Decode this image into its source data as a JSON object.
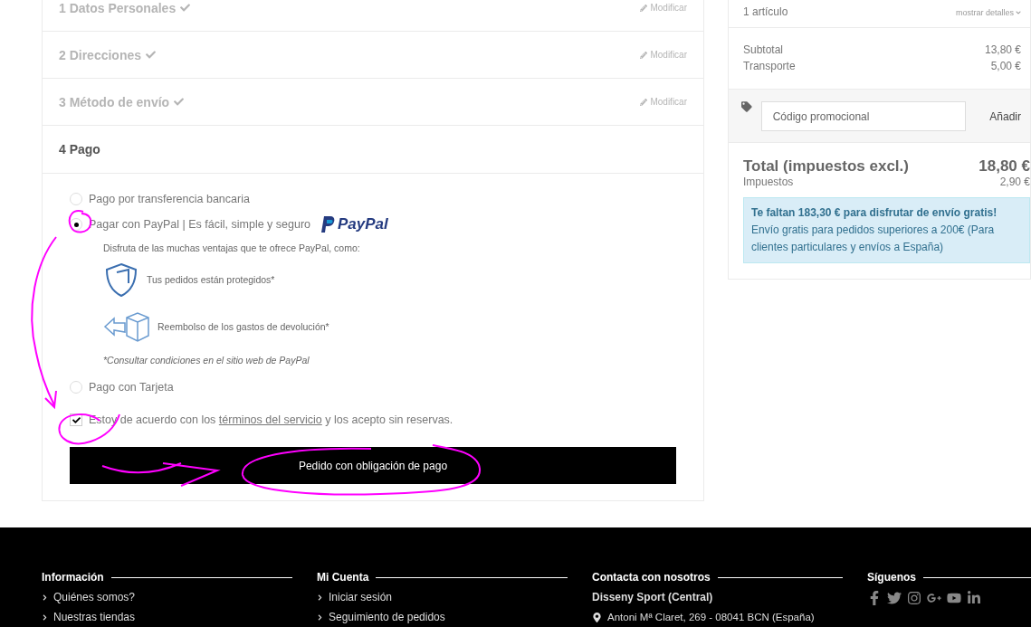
{
  "steps": [
    {
      "title": "1 Datos Personales",
      "complete": true,
      "edit_label": "Modificar"
    },
    {
      "title": "2 Direcciones",
      "complete": true,
      "edit_label": "Modificar"
    },
    {
      "title": "3 Método de envío",
      "complete": true,
      "edit_label": "Modificar"
    },
    {
      "title": "4 Pago",
      "complete": false
    }
  ],
  "payment": {
    "options": [
      {
        "label": "Pago por transferencia bancaria",
        "selected": false
      },
      {
        "label": "Pagar con PayPal | Es fácil, simple y seguro",
        "selected": true,
        "logo_text": "PayPal",
        "intro": "Disfruta de las muchas ventajas que te ofrece PayPal, como:",
        "benefits": [
          {
            "kind": "shield",
            "text": "Tus pedidos están protegidos*"
          },
          {
            "kind": "return",
            "text": "Reembolso de los gastos de devolución*"
          }
        ],
        "note": "*Consultar condiciones en el sitio web de PayPal"
      },
      {
        "label": "Pago con Tarjeta",
        "selected": false
      }
    ],
    "terms": {
      "checked": true,
      "before": "Estoy de acuerdo con los",
      "link": "términos del servicio",
      "after": "y los acepto sin reservas."
    },
    "submit_button": "Pedido con obligación de pago"
  },
  "summary": {
    "items_count": "1 artículo",
    "details_toggle": "mostrar detalles",
    "lines": [
      {
        "label": "Subtotal",
        "value": "13,80 €"
      },
      {
        "label": "Transporte",
        "value": "5,00 €"
      }
    ],
    "promo": {
      "placeholder": "Código promocional",
      "button": "Añadir"
    },
    "total": {
      "label": "Total (impuestos excl.)",
      "value": "18,80 €"
    },
    "taxes": {
      "label": "Impuestos",
      "value": "2,90 €"
    },
    "notice": {
      "title": "Te faltan 183,30 € para disfrutar de envío gratis!",
      "body": "Envío gratis para pedidos superiores a 200€ (Para clientes particulares y envíos a España)"
    }
  },
  "footer": {
    "columns": [
      {
        "kind": "links",
        "title": "Información",
        "items": [
          {
            "text": "Quiénes somos?"
          },
          {
            "text": "Nuestras tiendas"
          }
        ]
      },
      {
        "kind": "links",
        "title": "Mi Cuenta",
        "items": [
          {
            "text": "Iniciar sesión"
          },
          {
            "text": "Seguimiento de pedidos"
          }
        ]
      },
      {
        "kind": "contact",
        "title": "Contacta con nosotros",
        "company": "Disseny Sport (Central)",
        "address": "Antoni Mª Claret, 269 - 08041 BCN (España)"
      },
      {
        "kind": "social",
        "title": "Síguenos"
      }
    ]
  }
}
